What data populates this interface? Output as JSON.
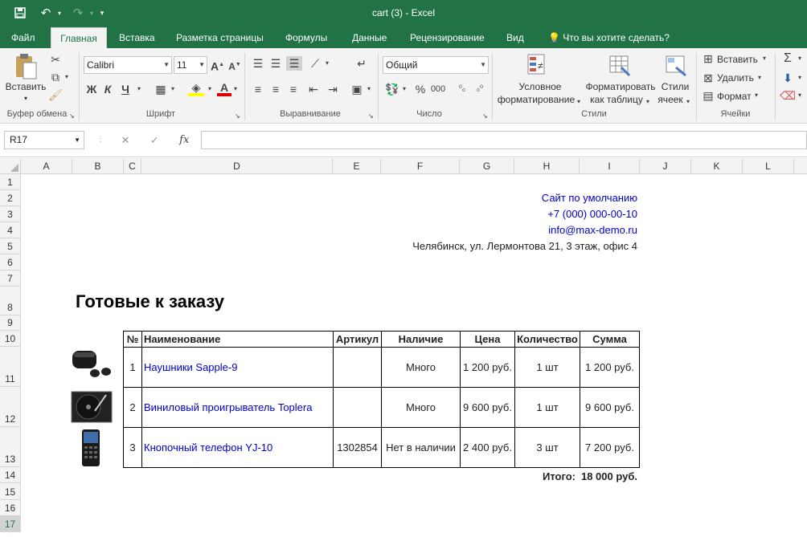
{
  "window": {
    "title": "cart (3) - Excel"
  },
  "quick_access": {
    "save_icon": "save-icon",
    "undo_icon": "undo-icon",
    "redo_icon": "redo-icon"
  },
  "tabs": [
    {
      "label": "Файл"
    },
    {
      "label": "Главная"
    },
    {
      "label": "Вставка"
    },
    {
      "label": "Разметка страницы"
    },
    {
      "label": "Формулы"
    },
    {
      "label": "Данные"
    },
    {
      "label": "Рецензирование"
    },
    {
      "label": "Вид"
    },
    {
      "label": "Что вы хотите сделать?"
    }
  ],
  "ribbon": {
    "clipboard": {
      "paste_label": "Вставить",
      "group_label": "Буфер обмена"
    },
    "font": {
      "font_name": "Calibri",
      "font_size": "11",
      "bold": "Ж",
      "italic": "К",
      "underline": "Ч",
      "group_label": "Шрифт"
    },
    "alignment": {
      "group_label": "Выравнивание"
    },
    "number": {
      "format": "Общий",
      "percent": "%",
      "thousands": "000",
      "group_label": "Число"
    },
    "styles": {
      "conditional_1": "Условное",
      "conditional_2": "форматирование",
      "format_table_1": "Форматировать",
      "format_table_2": "как таблицу",
      "cell_styles_1": "Стили",
      "cell_styles_2": "ячеек",
      "group_label": "Стили"
    },
    "cells": {
      "insert": "Вставить",
      "delete": "Удалить",
      "format": "Формат",
      "group_label": "Ячейки"
    }
  },
  "formula_bar": {
    "name_box": "R17",
    "fx": "fx",
    "value": ""
  },
  "columns": [
    "A",
    "B",
    "C",
    "D",
    "E",
    "F",
    "G",
    "H",
    "I",
    "J",
    "K",
    "L"
  ],
  "rows": [
    "1",
    "2",
    "3",
    "4",
    "5",
    "6",
    "7",
    "8",
    "9",
    "10",
    "11",
    "12",
    "13",
    "14",
    "15",
    "16",
    "17"
  ],
  "sheet": {
    "contact": {
      "site": "Сайт по умолчанию",
      "phone": "+7 (000) 000-00-10",
      "email": "info@max-demo.ru",
      "address": "Челябинск, ул. Лермонтова 21, 3 этаж, офис 4"
    },
    "heading": "Готовые к заказу",
    "table": {
      "headers": [
        "№",
        "Наименование",
        "Артикул",
        "Наличие",
        "Цена",
        "Количество",
        "Сумма"
      ],
      "rows": [
        {
          "num": "1",
          "name": "Наушники Sapple-9",
          "sku": "",
          "stock": "Много",
          "price": "1 200 руб.",
          "qty": "1 шт",
          "sum": "1 200 руб."
        },
        {
          "num": "2",
          "name": "Виниловый проигрыватель Toplera",
          "sku": "",
          "stock": "Много",
          "price": "9 600 руб.",
          "qty": "1 шт",
          "sum": "9 600 руб."
        },
        {
          "num": "3",
          "name": "Кнопочный телефон YJ-10",
          "sku": "1302854",
          "stock": "Нет в наличии",
          "price": "2 400 руб.",
          "qty": "3 шт",
          "sum": "7 200 руб."
        }
      ]
    },
    "total_label": "Итого:",
    "total_value": "18 000 руб."
  }
}
